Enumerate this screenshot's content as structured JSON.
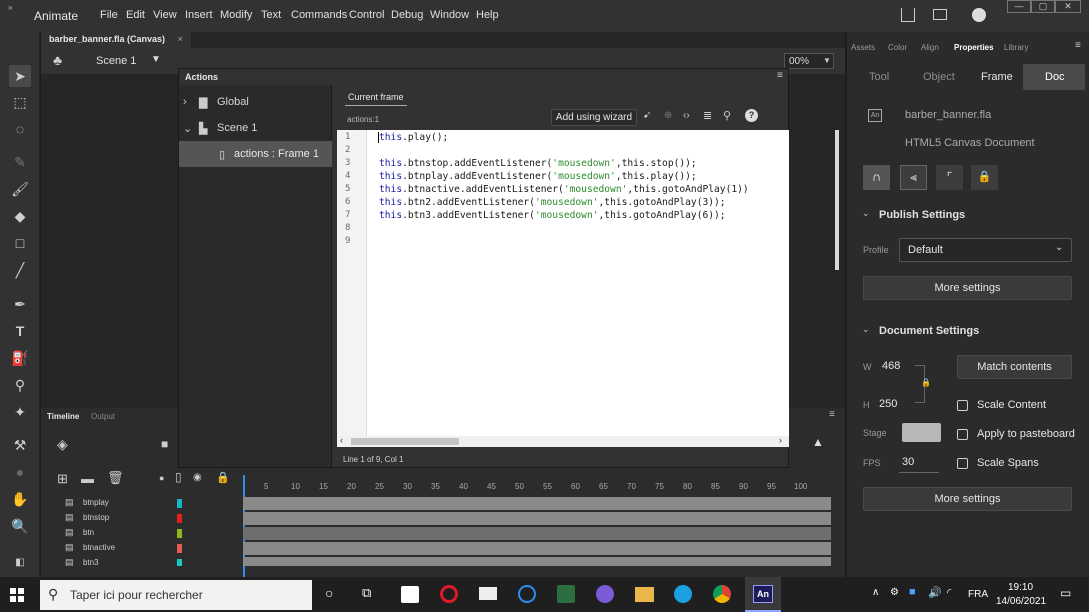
{
  "menubar": {
    "app_name": "Animate",
    "items": [
      "File",
      "Edit",
      "View",
      "Insert",
      "Modify",
      "Text",
      "Commands",
      "Control",
      "Debug",
      "Window",
      "Help"
    ]
  },
  "document": {
    "tab_label": "barber_banner.fla (Canvas)",
    "tab_close": "×",
    "scene_label": "Scene 1",
    "zoom_value": "00%"
  },
  "actions_panel": {
    "title": "Actions",
    "tree": {
      "global": "Global",
      "scene": "Scene 1",
      "frame": "actions : Frame 1"
    },
    "current_frame_tab": "Current frame",
    "crumb": "actions:1",
    "wizard_button": "Add using wizard",
    "line_numbers": [
      "1",
      "2",
      "3",
      "4",
      "5",
      "6",
      "7",
      "8",
      "9"
    ],
    "code_lines": [
      {
        "kw": "this",
        "rest": ".play();",
        "str": "",
        "tail": ""
      },
      {
        "kw": "",
        "rest": "",
        "str": "",
        "tail": ""
      },
      {
        "kw": "this",
        "rest": ".btnstop.addEventListener(",
        "str": "'mousedown'",
        "tail": ",this.stop());"
      },
      {
        "kw": "this",
        "rest": ".btnplay.addEventListener(",
        "str": "'mousedown'",
        "tail": ",this.play());"
      },
      {
        "kw": "this",
        "rest": ".btnactive.addEventListener(",
        "str": "'mousedown'",
        "tail": ",this.gotoAndPlay(1))"
      },
      {
        "kw": "this",
        "rest": ".btn2.addEventListener(",
        "str": "'mousedown'",
        "tail": ",this.gotoAndPlay(3));"
      },
      {
        "kw": "this",
        "rest": ".btn3.addEventListener(",
        "str": "'mousedown'",
        "tail": ",this.gotoAndPlay(6));"
      },
      {
        "kw": "",
        "rest": "",
        "str": "",
        "tail": ""
      },
      {
        "kw": "",
        "rest": "",
        "str": "",
        "tail": ""
      }
    ],
    "status": "Line 1 of 9, Col 1"
  },
  "timeline": {
    "tab_timeline": "Timeline",
    "tab_output": "Output",
    "ruler": [
      "5",
      "10",
      "15",
      "20",
      "25",
      "30",
      "35",
      "40",
      "45",
      "50",
      "55",
      "60",
      "65",
      "70",
      "75",
      "80",
      "85",
      "90",
      "95",
      "100"
    ],
    "layers": [
      {
        "name": "btnplay",
        "color": "#17b3c9"
      },
      {
        "name": "btnstop",
        "color": "#e02020"
      },
      {
        "name": "btn",
        "color": "#8ab81f"
      },
      {
        "name": "btnactive",
        "color": "#e85a5a"
      },
      {
        "name": "btn3",
        "color": "#17c9c0"
      }
    ]
  },
  "right_panel": {
    "tabs": [
      "Assets",
      "Color",
      "Align",
      "Properties",
      "Library"
    ],
    "subtabs": [
      "Tool",
      "Object",
      "Frame",
      "Doc"
    ],
    "doc_name": "barber_banner.fla",
    "doc_type": "HTML5 Canvas Document",
    "publish_title": "Publish Settings",
    "profile_label": "Profile",
    "profile_value": "Default",
    "more_settings": "More settings",
    "document_title": "Document Settings",
    "w_label": "W",
    "w_value": "468",
    "h_label": "H",
    "h_value": "250",
    "match_contents": "Match contents",
    "scale_content": "Scale Content",
    "stage_label": "Stage",
    "apply_pasteboard": "Apply to pasteboard",
    "fps_label": "FPS",
    "fps_value": "30",
    "scale_spans": "Scale Spans",
    "more_settings_2": "More settings",
    "stage_color": "#b7b7b7"
  },
  "taskbar": {
    "search_placeholder": "Taper ici pour rechercher",
    "language": "FRA",
    "time": "19:10",
    "date": "14/06/2021"
  }
}
